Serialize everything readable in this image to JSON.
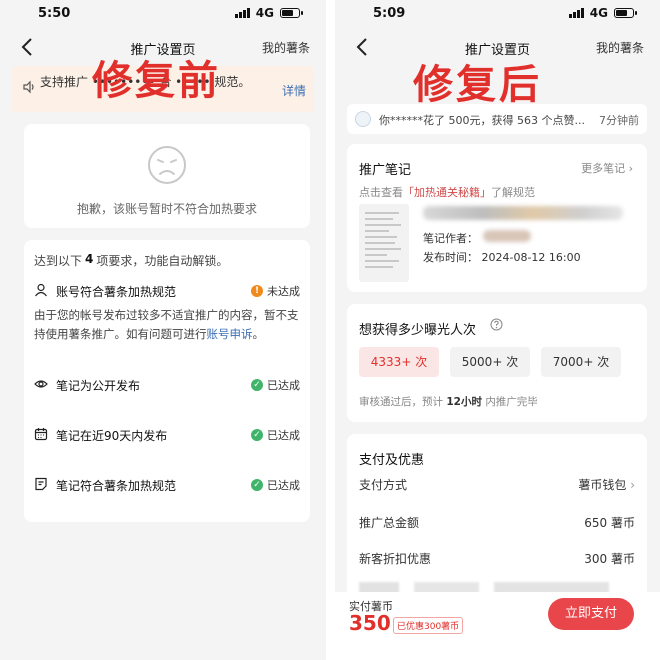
{
  "before": {
    "status": {
      "time": "5:50",
      "network": "4G"
    },
    "nav": {
      "title": "推广设置页",
      "right": "我的薯条"
    },
    "banner": {
      "text": "支持推广 ••••••••• 合 ••••• 规范。",
      "link": "详情"
    },
    "overlay": "修复前",
    "sorry": {
      "message": "抱歉，该账号暂时不符合加热要求"
    },
    "requirements": {
      "head_prefix": "达到以下",
      "head_count": "4",
      "head_suffix": "项要求，功能自动解锁。",
      "account": {
        "label": "账号符合薯条加热规范",
        "status": "未达成"
      },
      "desc": "由于您的帐号发布过较多不适宜推广的内容，暂不支持使用薯条推广。如有问题可进行",
      "appeal": "账号申诉",
      "desc_end": "。",
      "items": [
        {
          "label": "笔记为公开发布",
          "status": "已达成"
        },
        {
          "label": "笔记在近90天内发布",
          "status": "已达成"
        },
        {
          "label": "笔记符合薯条加热规范",
          "status": "已达成"
        }
      ]
    }
  },
  "after": {
    "status": {
      "time": "5:09",
      "network": "4G"
    },
    "nav": {
      "title": "推广设置页",
      "right": "我的薯条"
    },
    "overlay": "修复后",
    "record": {
      "text": "你******花了 500元，获得 563 个点赞...",
      "time": "7分钟前"
    },
    "note": {
      "title": "推广笔记",
      "more": "更多笔记",
      "hint_prefix": "点击查看",
      "hint_tag": "「加热通关秘籍」",
      "hint_suffix": "了解规范",
      "author_label": "笔记作者：",
      "publish": "发布时间：  2024-08-12 16:00"
    },
    "views": {
      "title": "想获得多少曝光人次",
      "options": [
        "4333+ 次",
        "5000+ 次",
        "7000+ 次"
      ],
      "tip_prefix": "审核通过后，预计",
      "tip_hours": "12小时",
      "tip_suffix": "内推广完毕"
    },
    "payment": {
      "title": "支付及优惠",
      "method_label": "支付方式",
      "method_value": "薯币钱包",
      "total_label": "推广总金额",
      "total_value": "650 薯币",
      "discount_label": "新客折扣优惠",
      "discount_value": "300 薯币"
    },
    "bottom": {
      "label": "实付薯币",
      "amount": "350",
      "discount_tag": "已优惠300薯币",
      "pay_button": "立即支付"
    }
  },
  "colors": {
    "accent_red": "#e1302c",
    "ok_green": "#3fb46a",
    "warn_orange": "#f08a1c",
    "link_blue": "#3d6fb4"
  }
}
